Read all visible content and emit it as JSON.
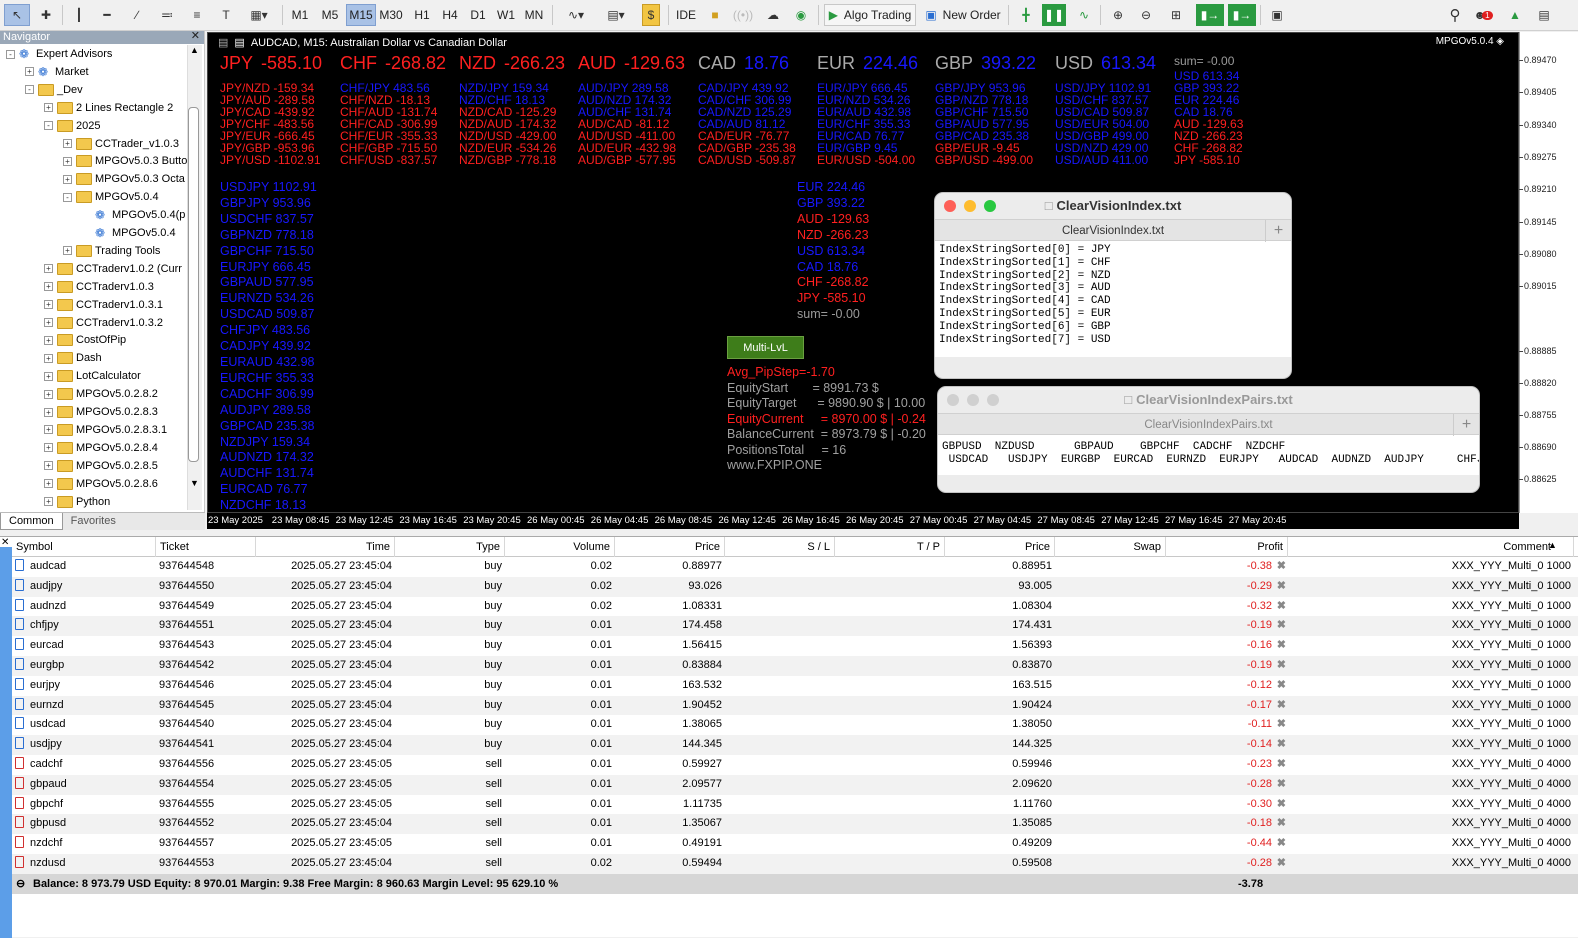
{
  "toolbar": {
    "timeframes": [
      "M1",
      "M5",
      "M15",
      "M30",
      "H1",
      "H4",
      "D1",
      "W1",
      "MN"
    ],
    "active_timeframe": "M15",
    "ide": "IDE",
    "algo_trading": "Algo Trading",
    "new_order": "New Order",
    "notif_badge": "1"
  },
  "navigator": {
    "title": "Navigator",
    "items": [
      {
        "label": "Expert Advisors",
        "level": 0,
        "type": "ea",
        "pm": "-"
      },
      {
        "label": "Market",
        "level": 1,
        "type": "ea",
        "pm": "+"
      },
      {
        "label": "_Dev",
        "level": 1,
        "type": "folder",
        "pm": "-"
      },
      {
        "label": "2 Lines Rectangle 2",
        "level": 2,
        "type": "folder",
        "pm": "+"
      },
      {
        "label": "2025",
        "level": 2,
        "type": "folder",
        "pm": "-"
      },
      {
        "label": "CCTrader_v1.0.3",
        "level": 3,
        "type": "folder",
        "pm": "+"
      },
      {
        "label": "MPGOv5.0.3 Butto",
        "level": 3,
        "type": "folder",
        "pm": "+"
      },
      {
        "label": "MPGOv5.0.3 Octa",
        "level": 3,
        "type": "folder",
        "pm": "+"
      },
      {
        "label": "MPGOv5.0.4",
        "level": 3,
        "type": "folder",
        "pm": "-"
      },
      {
        "label": "MPGOv5.0.4(p",
        "level": 4,
        "type": "ea",
        "pm": ""
      },
      {
        "label": "MPGOv5.0.4",
        "level": 4,
        "type": "ea",
        "pm": ""
      },
      {
        "label": "Trading Tools",
        "level": 3,
        "type": "folder",
        "pm": "+"
      },
      {
        "label": "CCTraderv1.0.2 (Curr",
        "level": 2,
        "type": "folder",
        "pm": "+"
      },
      {
        "label": "CCTraderv1.0.3",
        "level": 2,
        "type": "folder",
        "pm": "+"
      },
      {
        "label": "CCTraderv1.0.3.1",
        "level": 2,
        "type": "folder",
        "pm": "+"
      },
      {
        "label": "CCTraderv1.0.3.2",
        "level": 2,
        "type": "folder",
        "pm": "+"
      },
      {
        "label": "CostOfPip",
        "level": 2,
        "type": "folder",
        "pm": "+"
      },
      {
        "label": "Dash",
        "level": 2,
        "type": "folder",
        "pm": "+"
      },
      {
        "label": "LotCalculator",
        "level": 2,
        "type": "folder",
        "pm": "+"
      },
      {
        "label": "MPGOv5.0.2.8.2",
        "level": 2,
        "type": "folder",
        "pm": "+"
      },
      {
        "label": "MPGOv5.0.2.8.3",
        "level": 2,
        "type": "folder",
        "pm": "+"
      },
      {
        "label": "MPGOv5.0.2.8.3.1",
        "level": 2,
        "type": "folder",
        "pm": "+"
      },
      {
        "label": "MPGOv5.0.2.8.4",
        "level": 2,
        "type": "folder",
        "pm": "+"
      },
      {
        "label": "MPGOv5.0.2.8.5",
        "level": 2,
        "type": "folder",
        "pm": "+"
      },
      {
        "label": "MPGOv5.0.2.8.6",
        "level": 2,
        "type": "folder",
        "pm": "+"
      },
      {
        "label": "Python",
        "level": 2,
        "type": "folder",
        "pm": "+"
      }
    ],
    "tabs": [
      "Common",
      "Favorites"
    ]
  },
  "chart": {
    "title": "AUDCAD, M15:  Australian Dollar vs Canadian Dollar",
    "ea_label": "MPGOv5.0.4",
    "strength": [
      {
        "cur": "JPY",
        "val": "-585.10",
        "color": "red"
      },
      {
        "cur": "CHF",
        "val": "-268.82",
        "color": "red"
      },
      {
        "cur": "NZD",
        "val": "-266.23",
        "color": "red"
      },
      {
        "cur": "AUD",
        "val": "-129.63",
        "color": "red"
      },
      {
        "cur": "CAD",
        "val": "18.76",
        "color": "blue"
      },
      {
        "cur": "EUR",
        "val": "224.46",
        "color": "blue"
      },
      {
        "cur": "GBP",
        "val": "393.22",
        "color": "blue"
      },
      {
        "cur": "USD",
        "val": "613.34",
        "color": "blue"
      }
    ],
    "sum_top": "sum= -0.00",
    "pair_columns": [
      {
        "lines": [
          "JPY/NZD -159.34",
          "JPY/AUD -289.58",
          "JPY/CAD -439.92",
          "JPY/CHF -483.56",
          "JPY/EUR -666.45",
          "JPY/GBP -953.96",
          "JPY/USD -1102.91"
        ],
        "colors": [
          "red",
          "red",
          "red",
          "red",
          "red",
          "red",
          "red"
        ]
      },
      {
        "lines": [
          "CHF/JPY 483.56",
          "CHF/NZD -18.13",
          "CHF/AUD -131.74",
          "CHF/CAD -306.99",
          "CHF/EUR -355.33",
          "CHF/GBP -715.50",
          "CHF/USD -837.57"
        ],
        "colors": [
          "blue",
          "red",
          "red",
          "red",
          "red",
          "red",
          "red"
        ]
      },
      {
        "lines": [
          "NZD/JPY 159.34",
          "NZD/CHF 18.13",
          "NZD/CAD -125.29",
          "NZD/AUD -174.32",
          "NZD/USD -429.00",
          "NZD/EUR -534.26",
          "NZD/GBP -778.18"
        ],
        "colors": [
          "blue",
          "blue",
          "red",
          "red",
          "red",
          "red",
          "red"
        ]
      },
      {
        "lines": [
          "AUD/JPY 289.58",
          "AUD/NZD 174.32",
          "AUD/CHF 131.74",
          "AUD/CAD -81.12",
          "AUD/USD -411.00",
          "AUD/EUR -432.98",
          "AUD/GBP -577.95"
        ],
        "colors": [
          "blue",
          "blue",
          "blue",
          "red",
          "red",
          "red",
          "red"
        ]
      },
      {
        "lines": [
          "CAD/JPY 439.92",
          "CAD/CHF 306.99",
          "CAD/NZD 125.29",
          "CAD/AUD 81.12",
          "CAD/EUR -76.77",
          "CAD/GBP -235.38",
          "CAD/USD -509.87"
        ],
        "colors": [
          "blue",
          "blue",
          "blue",
          "blue",
          "red",
          "red",
          "red"
        ]
      },
      {
        "lines": [
          "EUR/JPY 666.45",
          "EUR/NZD 534.26",
          "EUR/AUD 432.98",
          "EUR/CHF 355.33",
          "EUR/CAD 76.77",
          "EUR/GBP 9.45",
          "EUR/USD -504.00"
        ],
        "colors": [
          "blue",
          "blue",
          "blue",
          "blue",
          "blue",
          "blue",
          "red"
        ]
      },
      {
        "lines": [
          "GBP/JPY 953.96",
          "GBP/NZD 778.18",
          "GBP/CHF 715.50",
          "GBP/AUD 577.95",
          "GBP/CAD 235.38",
          "GBP/EUR -9.45",
          "GBP/USD -499.00"
        ],
        "colors": [
          "blue",
          "blue",
          "blue",
          "blue",
          "blue",
          "red",
          "red"
        ]
      },
      {
        "lines": [
          "USD/JPY 1102.91",
          "USD/CHF 837.57",
          "USD/CAD 509.87",
          "USD/EUR 504.00",
          "USD/GBP 499.00",
          "USD/NZD 429.00",
          "USD/AUD 411.00"
        ],
        "colors": [
          "blue",
          "blue",
          "blue",
          "blue",
          "blue",
          "blue",
          "blue"
        ]
      }
    ],
    "sorted_right": {
      "sum": "sum= -0.00",
      "lines": [
        "USD 613.34",
        "GBP 393.22",
        "EUR 224.46",
        "CAD 18.76",
        "AUD -129.63",
        "NZD -266.23",
        "CHF -268.82",
        "JPY -585.10"
      ],
      "colors": [
        "blue",
        "blue",
        "blue",
        "blue",
        "red",
        "red",
        "red",
        "red"
      ]
    },
    "sorted_mid": {
      "lines": [
        "EUR 224.46",
        "GBP 393.22",
        "AUD -129.63",
        "NZD -266.23",
        "USD 613.34",
        "CAD 18.76",
        "CHF -268.82",
        "JPY -585.10"
      ],
      "colors": [
        "blue",
        "blue",
        "red",
        "red",
        "blue",
        "blue",
        "red",
        "red"
      ],
      "sum": "sum= -0.00"
    },
    "pair_list": [
      "USDJPY 1102.91",
      "GBPJPY 953.96",
      "USDCHF 837.57",
      "GBPNZD 778.18",
      "GBPCHF 715.50",
      "EURJPY 666.45",
      "GBPAUD 577.95",
      "EURNZD 534.26",
      "USDCAD 509.87",
      "CHFJPY 483.56",
      "CADJPY 439.92",
      "EURAUD 432.98",
      "EURCHF 355.33",
      "CADCHF 306.99",
      "AUDJPY 289.58",
      "GBPCAD 235.38",
      "NZDJPY 159.34",
      "AUDNZD 174.32",
      "AUDCHF 131.74",
      "EURCAD 76.77",
      "NZDCHF 18.13"
    ],
    "multi_button": "Multi-LvL",
    "equity": [
      {
        "label": "Avg_PipStep=-1.70",
        "color": "red"
      },
      {
        "label": "EquityStart       = 8991.73 $",
        "color": "gray"
      },
      {
        "label": "EquityTarget      = 9890.90 $ | 10.00",
        "color": "gray"
      },
      {
        "label": "EquityCurrent     = 8970.00 $ | -0.24",
        "color": "red"
      },
      {
        "label": "BalanceCurrent  = 8973.79 $ | -0.20",
        "color": "gray"
      },
      {
        "label": "PositionsTotal     = 16",
        "color": "gray"
      },
      {
        "label": "www.FXPIP.ONE",
        "color": "gray"
      }
    ],
    "price_axis": [
      "0.89470",
      "0.89405",
      "0.89340",
      "0.89275",
      "0.89210",
      "0.89145",
      "0.89080",
      "0.89015",
      "0.88885",
      "0.88820",
      "0.88755",
      "0.88690",
      "0.88625"
    ],
    "time_axis": [
      "23 May 2025",
      "23 May 08:45",
      "23 May 12:45",
      "23 May 16:45",
      "23 May 20:45",
      "26 May 00:45",
      "26 May 04:45",
      "26 May 08:45",
      "26 May 12:45",
      "26 May 16:45",
      "26 May 20:45",
      "27 May 00:45",
      "27 May 04:45",
      "27 May 08:45",
      "27 May 12:45",
      "27 May 16:45",
      "27 May 20:45"
    ]
  },
  "win_index": {
    "title": "ClearVisionIndex.txt",
    "tab": "ClearVisionIndex.txt",
    "content": "IndexStringSorted[0] = JPY\nIndexStringSorted[1] = CHF\nIndexStringSorted[2] = NZD\nIndexStringSorted[3] = AUD\nIndexStringSorted[4] = CAD\nIndexStringSorted[5] = EUR\nIndexStringSorted[6] = GBP\nIndexStringSorted[7] = USD"
  },
  "win_pairs": {
    "title": "ClearVisionIndexPairs.txt",
    "tab": "ClearVisionIndexPairs.txt",
    "content": "GBPUSD  NZDUSD      GBPAUD    GBPCHF  CADCHF  NZDCHF\n USDCAD   USDJPY  EURGBP  EURCAD  EURNZD  EURJPY   AUDCAD  AUDNZD  AUDJPY     CHFJPY"
  },
  "terminal": {
    "headers": [
      "Symbol",
      "Ticket",
      "Time",
      "Type",
      "Volume",
      "Price",
      "S / L",
      "T / P",
      "Price",
      "Swap",
      "Profit",
      "Comment"
    ],
    "rows": [
      [
        "audcad",
        "937644548",
        "2025.05.27 23:45:04",
        "buy",
        "0.02",
        "0.88977",
        "",
        "",
        "0.88951",
        "",
        "-0.38",
        "XXX_YYY_Multi_0 1000"
      ],
      [
        "audjpy",
        "937644550",
        "2025.05.27 23:45:04",
        "buy",
        "0.02",
        "93.026",
        "",
        "",
        "93.005",
        "",
        "-0.29",
        "XXX_YYY_Multi_0 1000"
      ],
      [
        "audnzd",
        "937644549",
        "2025.05.27 23:45:04",
        "buy",
        "0.02",
        "1.08331",
        "",
        "",
        "1.08304",
        "",
        "-0.32",
        "XXX_YYY_Multi_0 1000"
      ],
      [
        "chfjpy",
        "937644551",
        "2025.05.27 23:45:04",
        "buy",
        "0.01",
        "174.458",
        "",
        "",
        "174.431",
        "",
        "-0.19",
        "XXX_YYY_Multi_0 1000"
      ],
      [
        "eurcad",
        "937644543",
        "2025.05.27 23:45:04",
        "buy",
        "0.01",
        "1.56415",
        "",
        "",
        "1.56393",
        "",
        "-0.16",
        "XXX_YYY_Multi_0 1000"
      ],
      [
        "eurgbp",
        "937644542",
        "2025.05.27 23:45:04",
        "buy",
        "0.01",
        "0.83884",
        "",
        "",
        "0.83870",
        "",
        "-0.19",
        "XXX_YYY_Multi_0 1000"
      ],
      [
        "eurjpy",
        "937644546",
        "2025.05.27 23:45:04",
        "buy",
        "0.01",
        "163.532",
        "",
        "",
        "163.515",
        "",
        "-0.12",
        "XXX_YYY_Multi_0 1000"
      ],
      [
        "eurnzd",
        "937644545",
        "2025.05.27 23:45:04",
        "buy",
        "0.01",
        "1.90452",
        "",
        "",
        "1.90424",
        "",
        "-0.17",
        "XXX_YYY_Multi_0 1000"
      ],
      [
        "usdcad",
        "937644540",
        "2025.05.27 23:45:04",
        "buy",
        "0.01",
        "1.38065",
        "",
        "",
        "1.38050",
        "",
        "-0.11",
        "XXX_YYY_Multi_0 1000"
      ],
      [
        "usdjpy",
        "937644541",
        "2025.05.27 23:45:04",
        "buy",
        "0.01",
        "144.345",
        "",
        "",
        "144.325",
        "",
        "-0.14",
        "XXX_YYY_Multi_0 1000"
      ],
      [
        "cadchf",
        "937644556",
        "2025.05.27 23:45:05",
        "sell",
        "0.01",
        "0.59927",
        "",
        "",
        "0.59946",
        "",
        "-0.23",
        "XXX_YYY_Multi_0 4000"
      ],
      [
        "gbpaud",
        "937644554",
        "2025.05.27 23:45:05",
        "sell",
        "0.01",
        "2.09577",
        "",
        "",
        "2.09620",
        "",
        "-0.28",
        "XXX_YYY_Multi_0 4000"
      ],
      [
        "gbpchf",
        "937644555",
        "2025.05.27 23:45:05",
        "sell",
        "0.01",
        "1.11735",
        "",
        "",
        "1.11760",
        "",
        "-0.30",
        "XXX_YYY_Multi_0 4000"
      ],
      [
        "gbpusd",
        "937644552",
        "2025.05.27 23:45:04",
        "sell",
        "0.01",
        "1.35067",
        "",
        "",
        "1.35085",
        "",
        "-0.18",
        "XXX_YYY_Multi_0 4000"
      ],
      [
        "nzdchf",
        "937644557",
        "2025.05.27 23:45:05",
        "sell",
        "0.01",
        "0.49191",
        "",
        "",
        "0.49209",
        "",
        "-0.44",
        "XXX_YYY_Multi_0 4000"
      ],
      [
        "nzdusd",
        "937644553",
        "2025.05.27 23:45:04",
        "sell",
        "0.02",
        "0.59494",
        "",
        "",
        "0.59508",
        "",
        "-0.28",
        "XXX_YYY_Multi_0 4000"
      ]
    ],
    "footer": "Balance: 8 973.79 USD  Equity: 8 970.01  Margin: 9.38  Free Margin: 8 960.63  Margin Level: 95 629.10 %",
    "footer_total": "-3.78"
  },
  "colors": {
    "red": "#ff2020",
    "blue": "#1818ff",
    "profit_neg": "#e02020"
  }
}
